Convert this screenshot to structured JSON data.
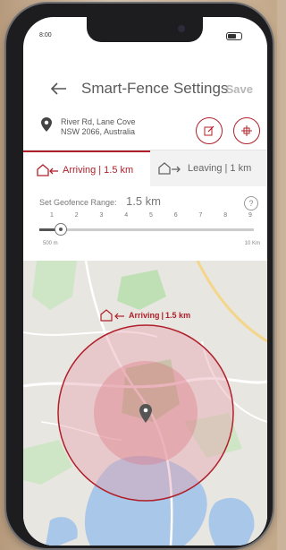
{
  "status_bar": {
    "time": "8:00"
  },
  "header": {
    "back_icon": "arrow-left-icon",
    "title": "Smart-Fence Settings",
    "save_label": "Save"
  },
  "address": {
    "line1": "River Rd, Lane Cove",
    "line2": "NSW 2066, Australia"
  },
  "tabs": [
    {
      "label": "Arriving",
      "distance": "1.5 km",
      "active": true,
      "icon": "house-arrow-in-icon"
    },
    {
      "label": "Leaving",
      "distance": "1 km",
      "active": false,
      "icon": "house-arrow-out-icon"
    }
  ],
  "range": {
    "label": "Set Geofence Range:",
    "value": "1.5 km",
    "ticks": [
      "1",
      "2",
      "3",
      "4",
      "5",
      "6",
      "7",
      "8",
      "9"
    ],
    "min_label": "500 m",
    "max_label": "10 Km",
    "fraction": 0.1
  },
  "map": {
    "badge_label": "Arriving",
    "badge_distance": "1.5 km"
  },
  "colors": {
    "accent": "#b0202a",
    "fence_fill": "#e8a3ad"
  }
}
